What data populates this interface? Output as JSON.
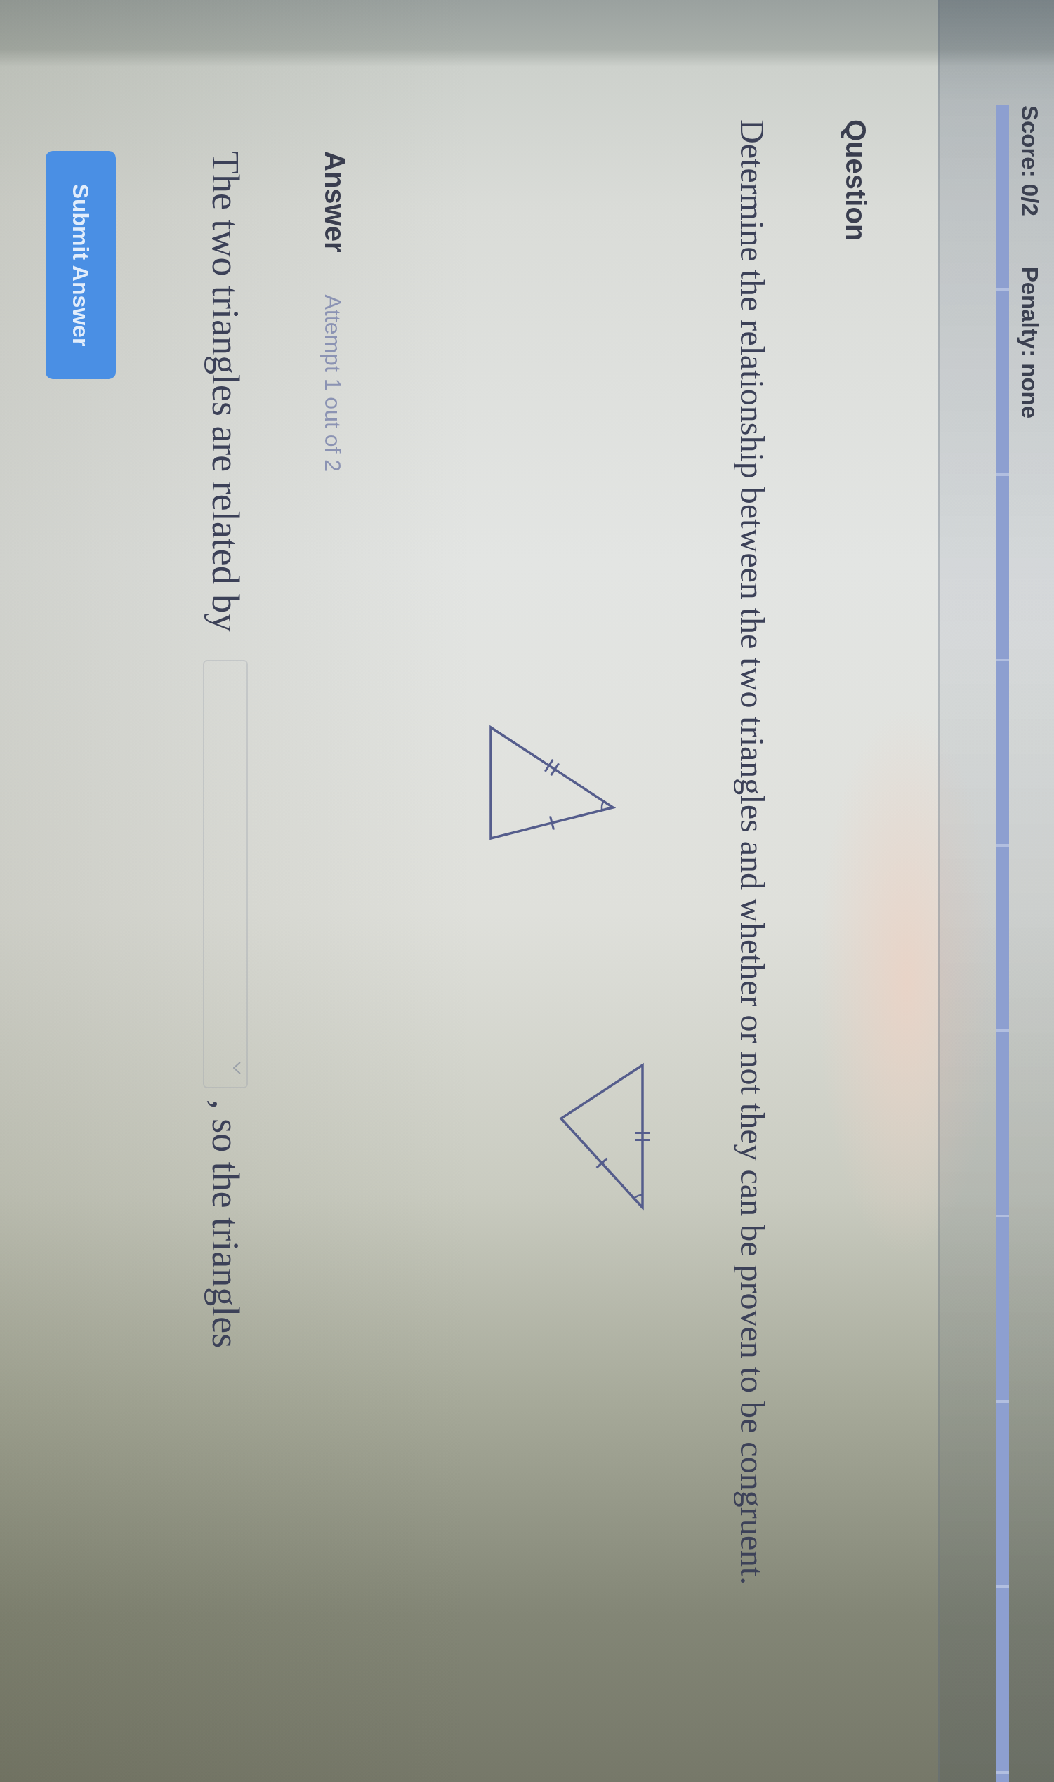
{
  "header": {
    "score": "Score: 0/2",
    "penalty": "Penalty: none"
  },
  "question": {
    "heading": "Question",
    "prompt": "Determine the relationship between the two triangles and whether or not they can be proven to be congruent.",
    "figure": {
      "triangles": [
        {
          "kind": "apex-up"
        },
        {
          "kind": "apex-down"
        }
      ]
    }
  },
  "answer": {
    "heading": "Answer",
    "attempt": "Attempt 1 out of 2",
    "parts": [
      {
        "kind": "text",
        "text": "The two triangles are related by"
      },
      {
        "kind": "dropdown"
      },
      {
        "kind": "text",
        "text": ", so the triangles"
      }
    ]
  },
  "submit_button": "Submit Answer"
}
